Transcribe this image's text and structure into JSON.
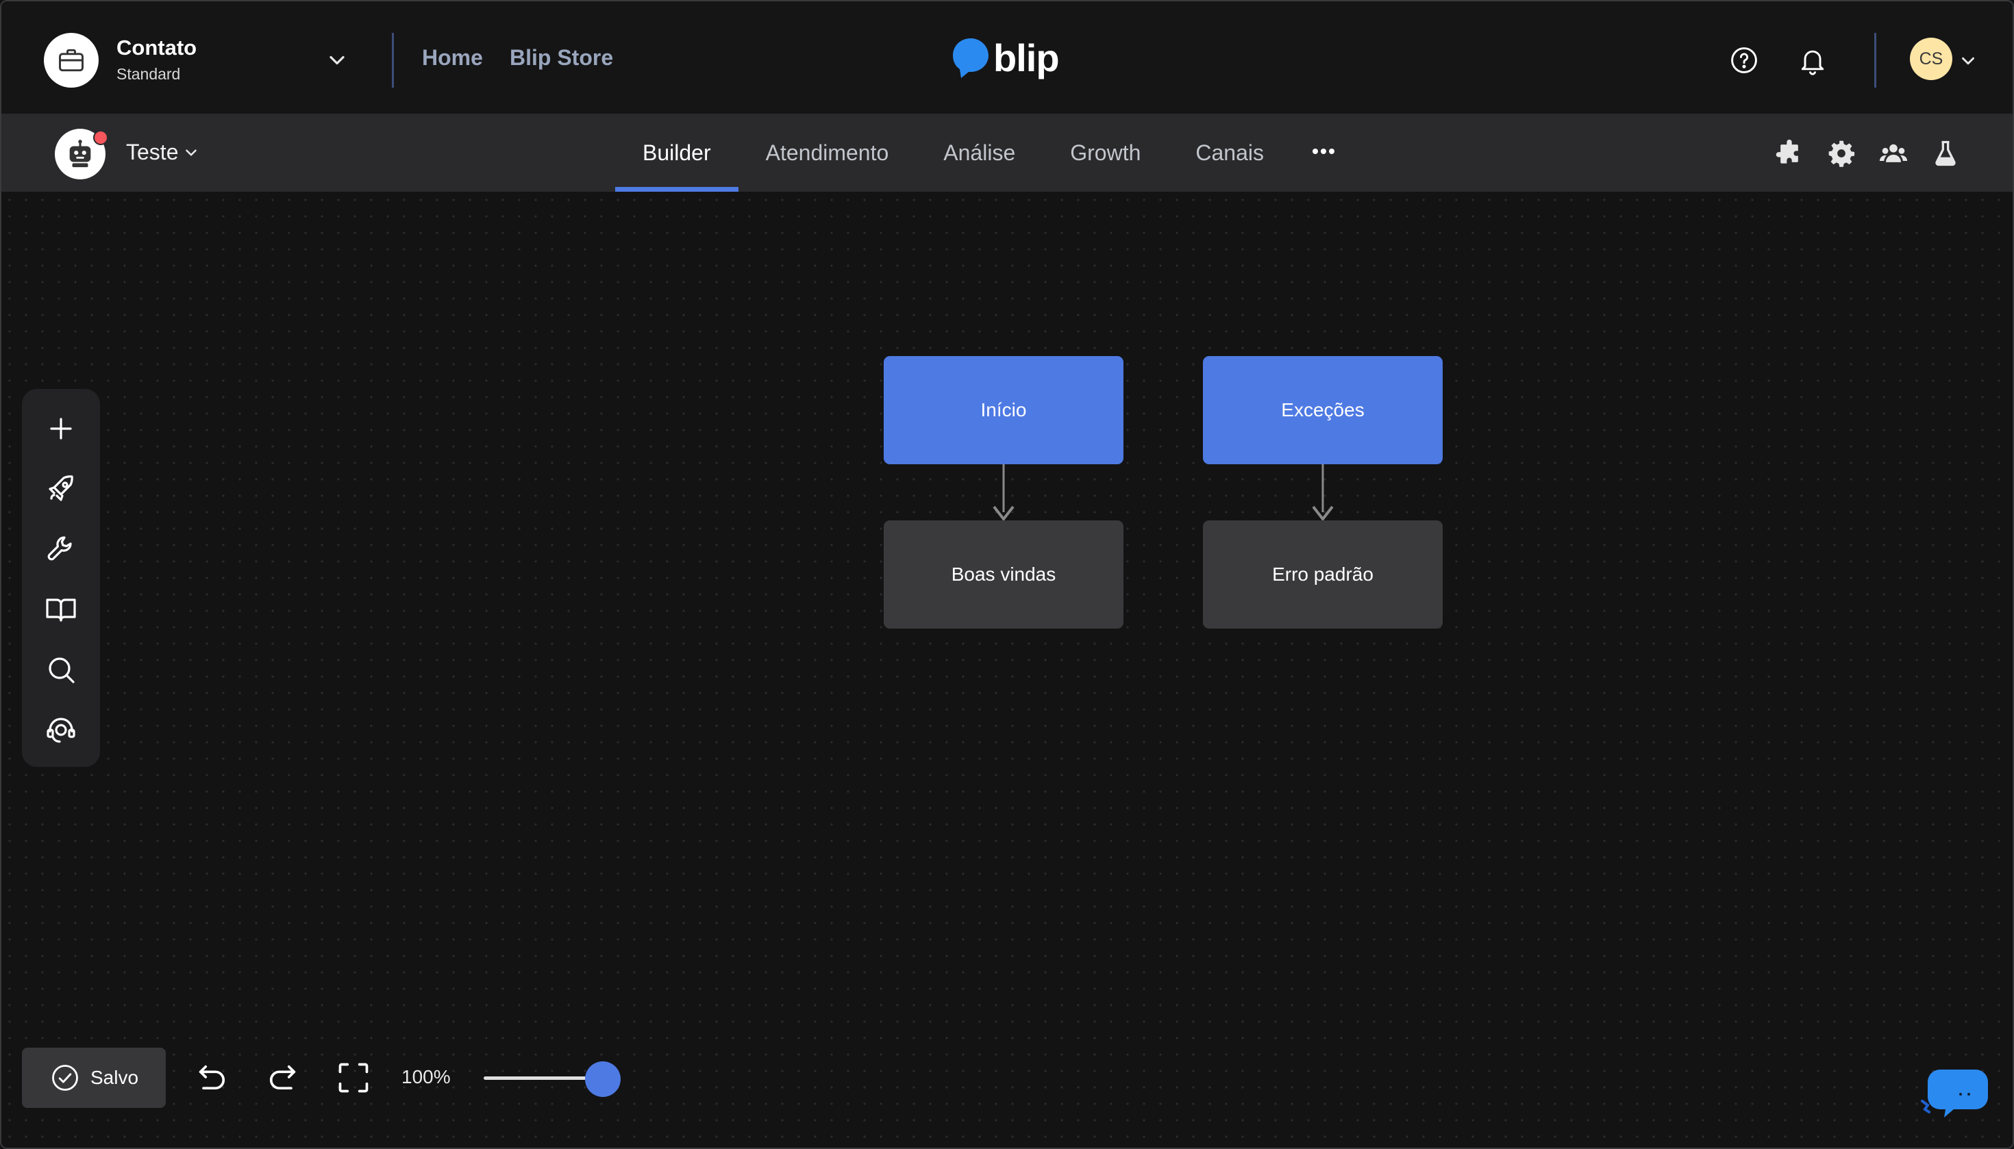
{
  "header": {
    "contract_name": "Contato",
    "contract_plan": "Standard",
    "nav": [
      "Home",
      "Blip Store"
    ],
    "logo_text": "blip",
    "user_initials": "CS"
  },
  "subbar": {
    "bot_name": "Teste",
    "tabs": [
      "Builder",
      "Atendimento",
      "Análise",
      "Growth",
      "Canais"
    ],
    "active_tab": "Builder"
  },
  "tools": [
    "plus-icon",
    "rocket-icon",
    "wrench-icon",
    "book-icon",
    "search-icon",
    "support-icon"
  ],
  "blocks": {
    "start": {
      "label": "Início"
    },
    "welcome": {
      "label": "Boas vindas"
    },
    "exceptions": {
      "label": "Exceções"
    },
    "default_error": {
      "label": "Erro padrão"
    }
  },
  "footer": {
    "saved_label": "Salvo",
    "zoom_label": "100%",
    "zoom_level": 1.0
  },
  "colors": {
    "accent": "#4e7ae3",
    "background": "#131314",
    "panel": "#2a2a2c",
    "block_dark": "#3a3a3c",
    "notification": "#f6565c",
    "avatar": "#fde5a5"
  }
}
